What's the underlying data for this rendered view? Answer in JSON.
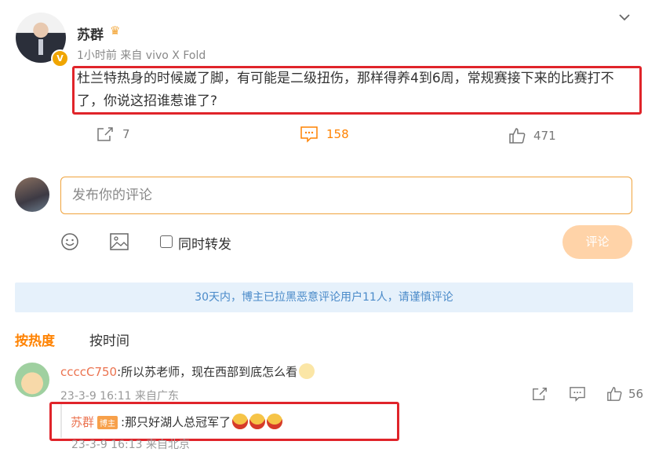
{
  "post": {
    "author": "苏群",
    "author_badge": "crown-icon",
    "meta": "1小时前 来自 vivo X Fold",
    "text": "杜兰特热身的时候崴了脚，有可能是二级扭伤，那样得养4到6周，常规赛接下来的比赛打不了，你说这招谁惹谁了?",
    "verified": "V",
    "actions": {
      "repost": "7",
      "comment": "158",
      "like": "471"
    }
  },
  "composer": {
    "placeholder": "发布你的评论",
    "also_repost": "同时转发",
    "send": "评论"
  },
  "notice": "30天内，博主已拉黑恶意评论用户11人，请谨慎评论",
  "sort_tabs": {
    "hot": "按热度",
    "time": "按时间"
  },
  "comments": [
    {
      "user": "ccccC750",
      "text": ":所以苏老师，现在西部到底怎么看",
      "meta": "23-3-9 16:11 来自广东",
      "likes": "56",
      "reply": {
        "user": "苏群",
        "tag": "博主",
        "text": ":那只好湖人总冠军了",
        "meta": "23-3-9 16:13 来自北京"
      }
    }
  ],
  "colors": {
    "accent": "#ff8200",
    "highlight": "#e0242a",
    "link": "#eb7350",
    "notice_bg": "#e6f1fb"
  }
}
